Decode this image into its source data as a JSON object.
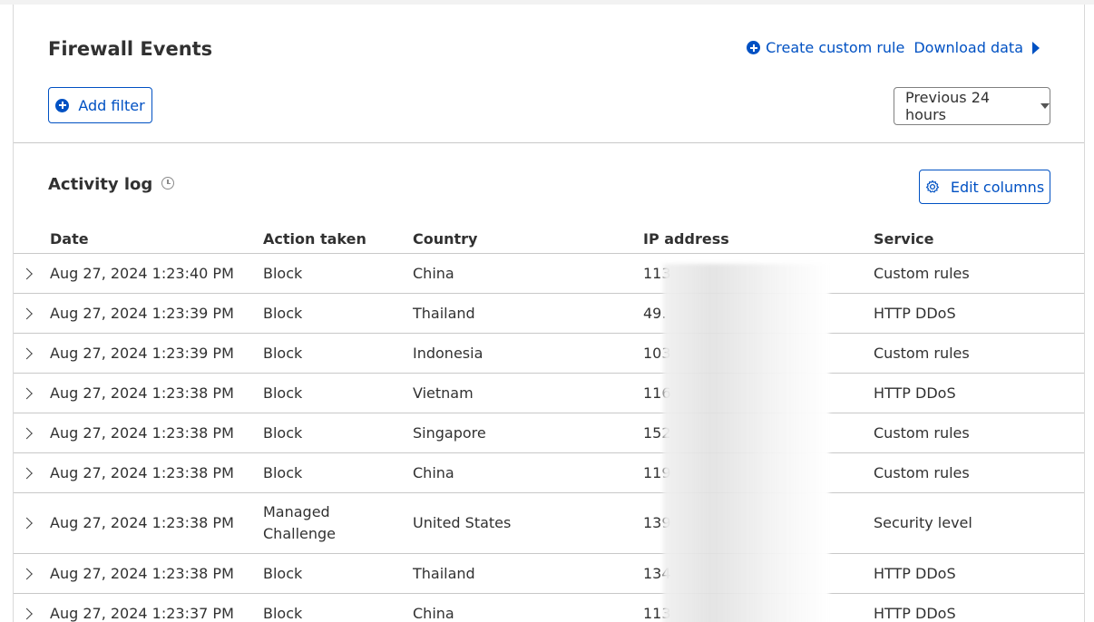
{
  "header": {
    "title": "Firewall Events",
    "create_rule_label": "Create custom rule",
    "download_label": "Download data"
  },
  "filters": {
    "add_filter_label": "Add filter",
    "time_range": "Previous 24 hours"
  },
  "activity": {
    "title": "Activity log",
    "edit_columns_label": "Edit columns"
  },
  "table": {
    "columns": [
      "Date",
      "Action taken",
      "Country",
      "IP address",
      "Service"
    ],
    "rows": [
      {
        "date": "Aug 27, 2024 1:23:40 PM",
        "action": "Block",
        "country": "China",
        "ip": "113",
        "service": "Custom rules"
      },
      {
        "date": "Aug 27, 2024 1:23:39 PM",
        "action": "Block",
        "country": "Thailand",
        "ip": "49.",
        "service": "HTTP DDoS"
      },
      {
        "date": "Aug 27, 2024 1:23:39 PM",
        "action": "Block",
        "country": "Indonesia",
        "ip": "103",
        "service": "Custom rules"
      },
      {
        "date": "Aug 27, 2024 1:23:38 PM",
        "action": "Block",
        "country": "Vietnam",
        "ip": "116",
        "service": "HTTP DDoS"
      },
      {
        "date": "Aug 27, 2024 1:23:38 PM",
        "action": "Block",
        "country": "Singapore",
        "ip": "152",
        "service": "Custom rules"
      },
      {
        "date": "Aug 27, 2024 1:23:38 PM",
        "action": "Block",
        "country": "China",
        "ip": "119",
        "service": "Custom rules"
      },
      {
        "date": "Aug 27, 2024 1:23:38 PM",
        "action": "Managed\nChallenge",
        "country": "United States",
        "ip": "139",
        "service": "Security level"
      },
      {
        "date": "Aug 27, 2024 1:23:38 PM",
        "action": "Block",
        "country": "Thailand",
        "ip": "134",
        "service": "HTTP DDoS"
      },
      {
        "date": "Aug 27, 2024 1:23:37 PM",
        "action": "Block",
        "country": "China",
        "ip": "113",
        "service": "HTTP DDoS"
      }
    ]
  },
  "icons": {
    "plus": "plus-circle-icon",
    "arrow": "triangle-right-icon",
    "caret": "caret-down-icon",
    "clock": "clock-icon",
    "gear": "gear-icon",
    "expand": "chevron-right-icon"
  },
  "colors": {
    "accent": "#0051c3",
    "text": "#313131",
    "border": "#c8c8c8"
  }
}
